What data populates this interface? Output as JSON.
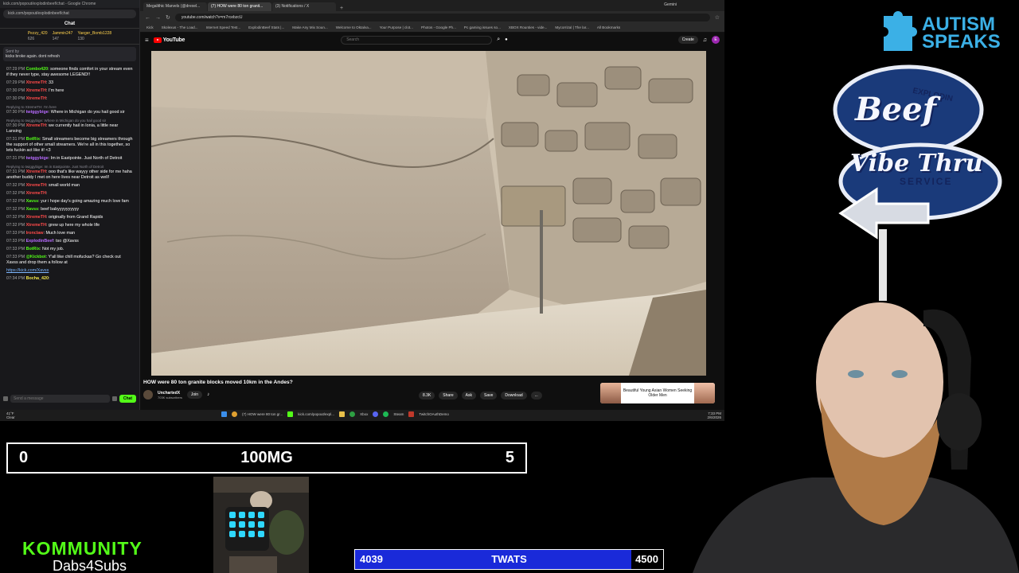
{
  "chat_window": {
    "title": "kick.com/popout/explodinbeef/chat - Google Chrome",
    "url": "kick.com/popout/explodinbeef/chat",
    "header": "Chat",
    "leaders": [
      {
        "name": "Pezzy_420",
        "count": "626"
      },
      {
        "name": "Jammin247",
        "count": "147"
      },
      {
        "name": "Yaeger_Bomb1228",
        "count": "130"
      }
    ],
    "pinned_by": "Sent by",
    "pinned_msg": "kicks broke again. dont refresh",
    "messages": [
      {
        "time": "07:29 PM",
        "user": "Combo420",
        "color": "u-green",
        "text": "someone finds comfort in your stream even if they never type, stay awesome LEGEND!!"
      },
      {
        "time": "07:29 PM",
        "user": "XtremeTH",
        "color": "u-red",
        "text": "33"
      },
      {
        "time": "07:30 PM",
        "user": "XtremeTH",
        "color": "u-red",
        "text": "I'm here"
      },
      {
        "time": "07:30 PM",
        "user": "XtremeTH",
        "color": "u-red",
        "text": ""
      },
      {
        "reply": "Replying to XtremeTH: I'm here",
        "time": "07:30 PM",
        "user": "twiggybige",
        "color": "u-purple",
        "text": "Where in Michigan do you hail good sir"
      },
      {
        "reply": "Replying to twiggybige: Where in Michigan do you hail good sir",
        "time": "07:30 PM",
        "user": "XtremeTH",
        "color": "u-red",
        "text": "we currently hail in Ionia, a little near Lansing"
      },
      {
        "time": "07:31 PM",
        "user": "BotRix",
        "color": "u-green",
        "text": "Small streamers become big streamers through the support of other small streamers. We're all in this together, so lets fuckin act like it! <3"
      },
      {
        "time": "07:31 PM",
        "user": "twiggybige",
        "color": "u-purple",
        "text": "Im in Eastpointe. Just North of Detroit"
      },
      {
        "reply": "Replying to twiggybige: Im in Eastpointe. Just North of Detroit",
        "time": "07:31 PM",
        "user": "XtremeTH",
        "color": "u-red",
        "text": "ooo that's like wayyy other side for me haha another buddy I met on here lives near Detroit as well!"
      },
      {
        "time": "07:32 PM",
        "user": "XtremeTH",
        "color": "u-red",
        "text": "small world man"
      },
      {
        "time": "07:32 PM",
        "user": "XtremeTH",
        "color": "u-red",
        "text": ""
      },
      {
        "time": "07:32 PM",
        "user": "Xavss",
        "color": "u-green",
        "text": "yur i hope day's going amazing much love fam"
      },
      {
        "time": "07:32 PM",
        "user": "Xavss",
        "color": "u-green",
        "text": "beef babyyyyyyyyyy"
      },
      {
        "time": "07:32 PM",
        "user": "XtremeTH",
        "color": "u-red",
        "text": "originally from Grand Rapids"
      },
      {
        "time": "07:32 PM",
        "user": "XtremeTH",
        "color": "u-red",
        "text": "grew up here my whole life"
      },
      {
        "time": "07:33 PM",
        "user": "Ironclaw",
        "color": "u-red",
        "text": "Much love man"
      },
      {
        "time": "07:33 PM",
        "user": "ExplodinBeef",
        "color": "u-purple",
        "text": "tso @Xavss"
      },
      {
        "time": "07:33 PM",
        "user": "BotRix",
        "color": "u-green",
        "text": "Not my job."
      },
      {
        "time": "07:33 PM",
        "user": "@Kickbot",
        "color": "u-green",
        "text": "Y'all like chill mofuckas? Go check out Xavss and drop them a follow at"
      },
      {
        "time": "",
        "user": "",
        "color": "u-green",
        "text": "",
        "link": "https://kick.com/Xavss"
      },
      {
        "time": "07:34 PM",
        "user": "Bocha_420",
        "color": "u-yellow",
        "text": ""
      }
    ],
    "input_placeholder": "Send a message",
    "send_label": "Chat"
  },
  "browser": {
    "tabs": [
      "Megalithic Marvels (@drexel...",
      "(7) HOW were 80 ton granit...",
      "(3) Notifications / X"
    ],
    "new_tab": "+",
    "gemini": "Gemini",
    "url": "youtube.com/watch?v=m7rcebzcU",
    "bookmarks": [
      "Kick",
      "Skolexus - The Load...",
      "Internet Speed Test...",
      "ExplodinBeef Stats |...",
      "Make Any Mix Soun...",
      "Welcome to Oktalva...",
      "Your Purpose | clot...",
      "Photos - Google Ph...",
      "Pc gaming issues so...",
      "XBOX Rounties - vide...",
      "Mycorrizal | The lar...",
      "All Bookmarks"
    ],
    "youtube": {
      "logo": "YouTube",
      "search_placeholder": "Search",
      "create": "Create",
      "avatar_letter": "E",
      "video_title": "HOW were 80 ton granite blocks moved 10km in the Andes?",
      "channel": "UnchartedX",
      "subs": "703K subscribers",
      "join": "Join",
      "actions": [
        "8.3K",
        "Share",
        "Ask",
        "Save",
        "Download",
        "..."
      ],
      "ad_text": "Beautiful Young Asian Women Seeking Older Men"
    }
  },
  "taskbar": {
    "weather_temp": "41°F",
    "weather_desc": "Clear",
    "items": [
      "(7) HOW were 80 ton gr...",
      "kick.com/popout/expl...",
      "Xbox",
      "Steam",
      "TwitchOAuthDemo"
    ],
    "time": "7:33 PM",
    "date": "2/6/2026"
  },
  "scoreboard": {
    "left": "0",
    "title": "100MG",
    "right": "5"
  },
  "kommunity": {
    "logo": "KOMMUNITY",
    "sub": "Dabs4Subs"
  },
  "goal": {
    "current": "4039",
    "name": "TWATS",
    "max": "4500",
    "fraction": 0.8976
  },
  "overlay": {
    "autism_line1": "AUTISM",
    "autism_line2": "SPEAKS",
    "sign_explodin": "EXPLODIN",
    "sign_beef": "Beef",
    "sign_vibe": "Vibe Thru",
    "sign_service": "SERVICE"
  }
}
